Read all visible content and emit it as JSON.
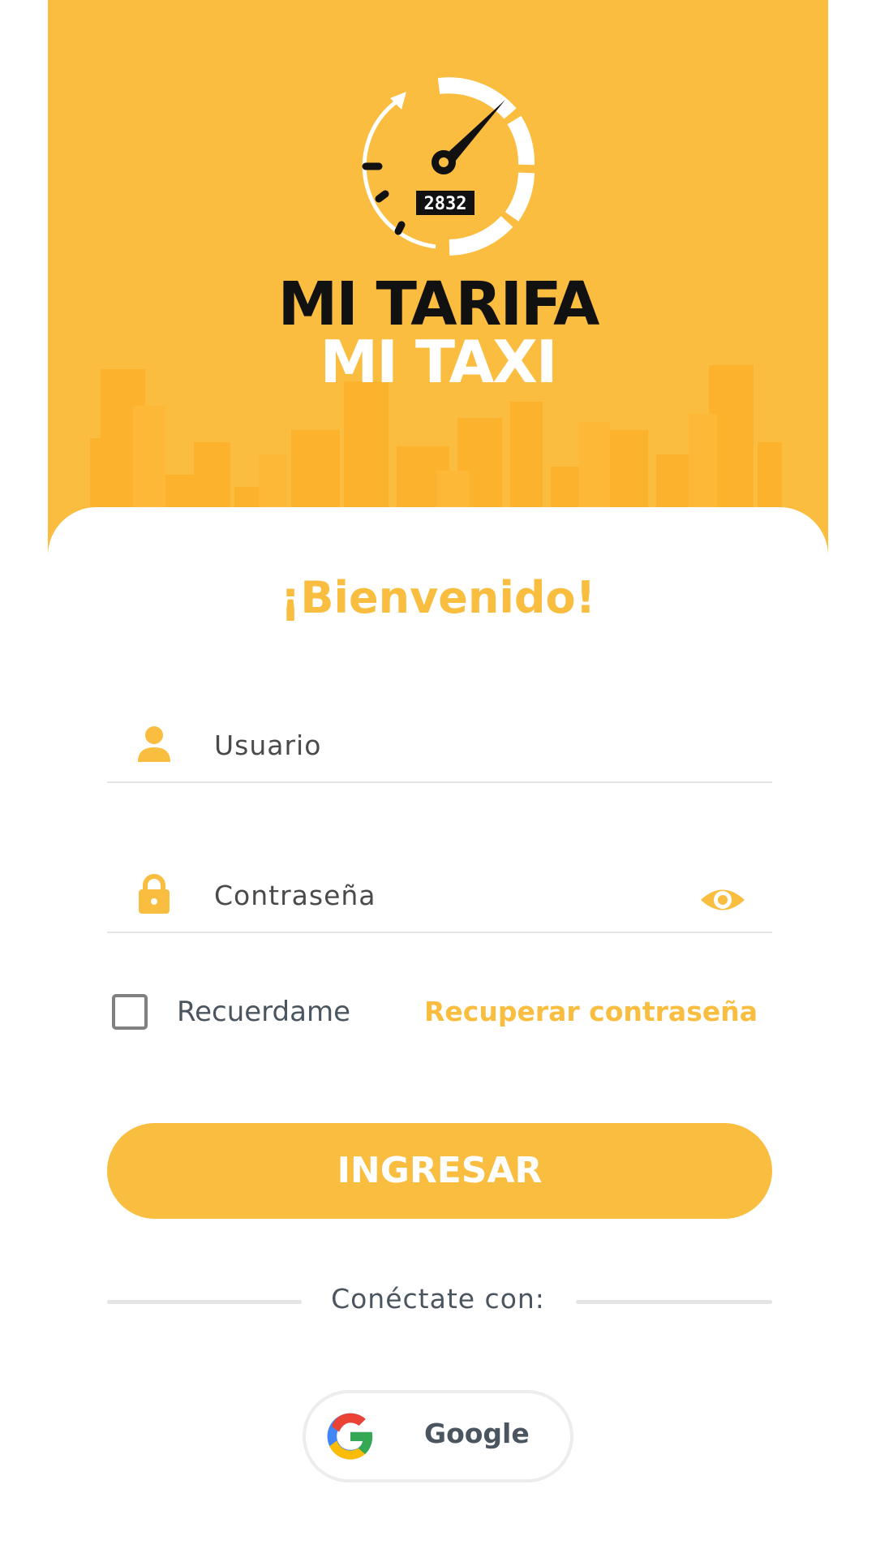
{
  "colors": {
    "brand_yellow": "#fbbd3f",
    "accent_yellow": "#f9bd3f",
    "text_dark": "#111111",
    "text_gray": "#4b5560"
  },
  "header": {
    "brand_line1": "MI TARIFA",
    "brand_line2": "MI TAXI",
    "meter_reading": "2832"
  },
  "login": {
    "welcome": "¡Bienvenido!",
    "username": {
      "placeholder": "Usuario",
      "value": "",
      "icon": "user-icon"
    },
    "password": {
      "placeholder": "Contraseña",
      "value": "",
      "icon": "lock-icon",
      "toggle_icon": "eye-icon"
    },
    "remember_label": "Recuerdame",
    "remember_checked": false,
    "recover_link": "Recuperar contraseña",
    "submit_label": "INGRESAR",
    "connect_with": "Conéctate con:",
    "google_label": "Google"
  }
}
